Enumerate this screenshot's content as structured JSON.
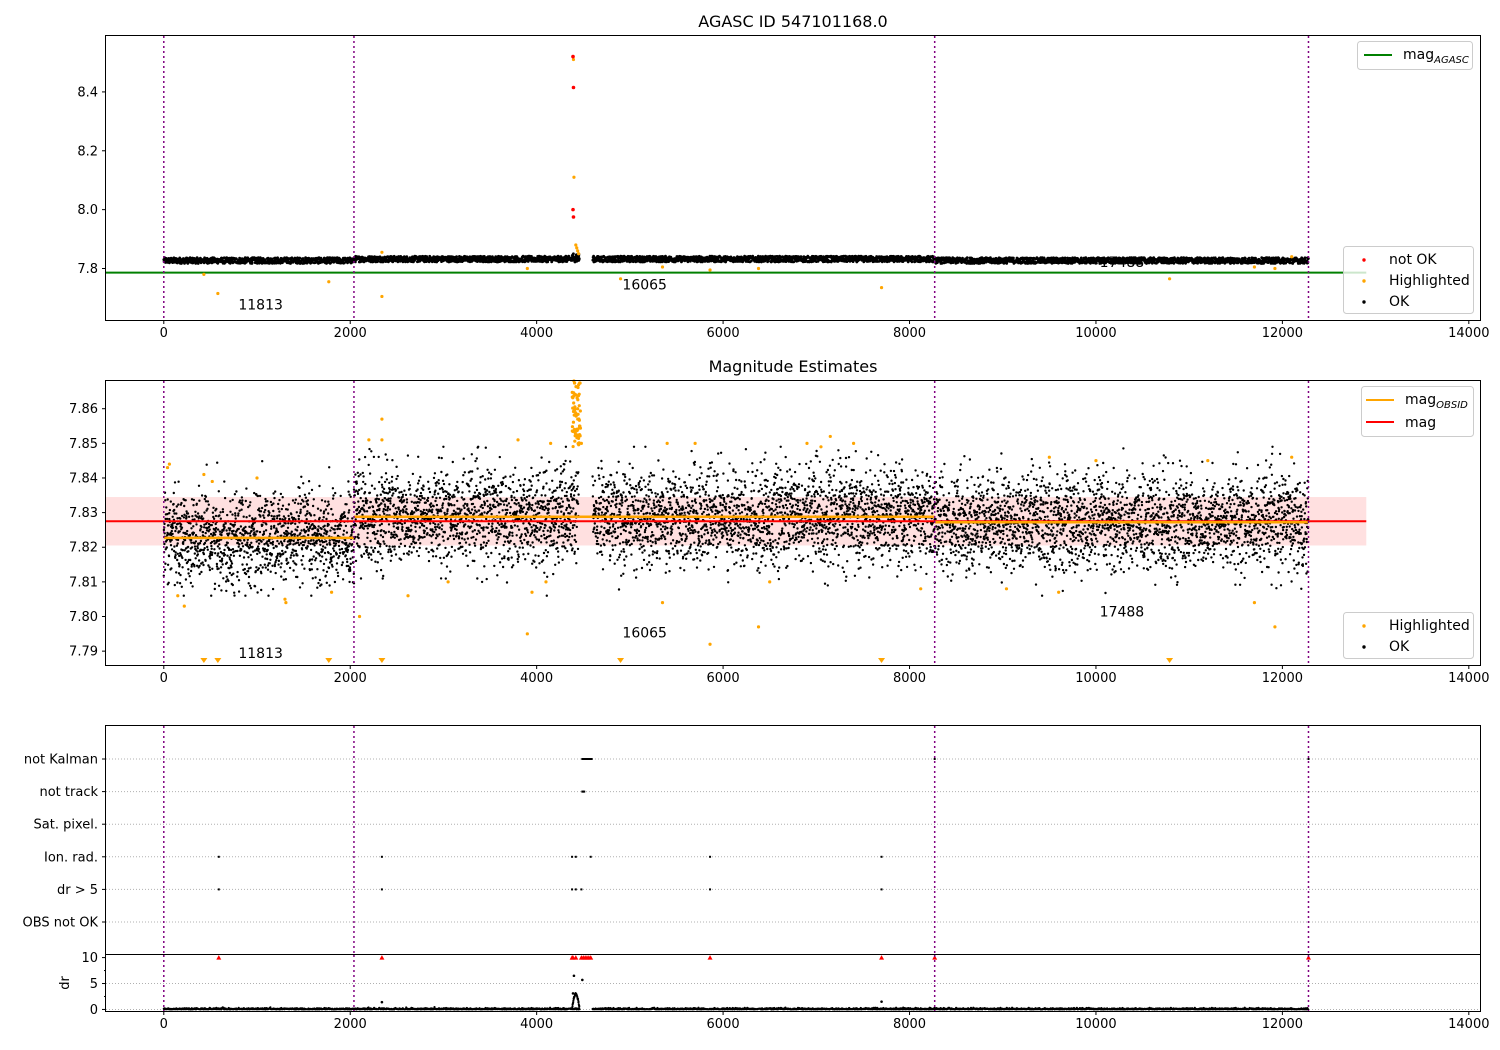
{
  "chart_data": [
    {
      "type": "scatter",
      "title": "AGASC ID 547101168.0",
      "xlim": [
        -620,
        14120
      ],
      "ylim": [
        7.625,
        8.59
      ],
      "xticks": [
        0,
        2000,
        4000,
        6000,
        8000,
        10000,
        12000,
        14000
      ],
      "yticks": [
        7.8,
        8.0,
        8.2,
        8.4
      ],
      "xtick_labels": [
        "0",
        "2000",
        "4000",
        "6000",
        "8000",
        "10000",
        "12000",
        "14000"
      ],
      "ytick_labels": [
        "7.8",
        "8.0",
        "8.2",
        "8.4"
      ],
      "obsid_boundaries": [
        0,
        2040,
        8270,
        12280
      ],
      "obsid_labels": [
        {
          "text": "11813",
          "x": 800,
          "y": 7.66
        },
        {
          "text": "16065",
          "x": 4920,
          "y": 7.728
        },
        {
          "text": "17488",
          "x": 10040,
          "y": 7.805
        }
      ],
      "mag_agasc": 7.786,
      "ok_band": {
        "base": 7.827,
        "amp": 0.01
      },
      "highlighted": [
        [
          4390,
          8.52
        ],
        [
          4395,
          8.51
        ],
        [
          4400,
          8.11
        ],
        [
          4420,
          7.88
        ],
        [
          4430,
          7.87
        ],
        [
          4440,
          7.86
        ],
        [
          4450,
          7.85
        ],
        [
          430,
          7.78
        ],
        [
          580,
          7.715
        ],
        [
          1770,
          7.755
        ],
        [
          2340,
          7.705
        ],
        [
          2340,
          7.855
        ],
        [
          3900,
          7.8
        ],
        [
          4900,
          7.765
        ],
        [
          5350,
          7.805
        ],
        [
          5860,
          7.795
        ],
        [
          6380,
          7.8
        ],
        [
          7700,
          7.735
        ],
        [
          10790,
          7.765
        ],
        [
          11700,
          7.805
        ],
        [
          11920,
          7.8
        ],
        [
          12100,
          7.84
        ]
      ],
      "not_ok": [
        [
          4390,
          8.52
        ],
        [
          4395,
          8.415
        ],
        [
          4390,
          8.0
        ],
        [
          4395,
          7.975
        ]
      ],
      "legend_upper": [
        {
          "label": "mag",
          "sub": "AGASC",
          "color": "#008000"
        }
      ],
      "legend_lower": [
        {
          "label": "not OK",
          "color": "#ff0000"
        },
        {
          "label": "Highlighted",
          "color": "#ffa500"
        },
        {
          "label": "OK",
          "color": "#000000"
        }
      ]
    },
    {
      "type": "scatter",
      "title": "Magnitude Estimates",
      "xlim": [
        -620,
        14120
      ],
      "ylim": [
        7.786,
        7.868
      ],
      "xticks": [
        0,
        2000,
        4000,
        6000,
        8000,
        10000,
        12000,
        14000
      ],
      "yticks": [
        7.79,
        7.8,
        7.81,
        7.82,
        7.83,
        7.84,
        7.85,
        7.86
      ],
      "xtick_labels": [
        "0",
        "2000",
        "4000",
        "6000",
        "8000",
        "10000",
        "12000",
        "14000"
      ],
      "ytick_labels": [
        "7.79",
        "7.80",
        "7.81",
        "7.82",
        "7.83",
        "7.84",
        "7.85",
        "7.86"
      ],
      "obsid_boundaries": [
        0,
        2040,
        8270,
        12280
      ],
      "obsid_labels": [
        {
          "text": "11813",
          "x": 800,
          "y": 7.788
        },
        {
          "text": "16065",
          "x": 4920,
          "y": 7.794
        },
        {
          "text": "17488",
          "x": 10040,
          "y": 7.8
        }
      ],
      "mag": 7.8275,
      "mag_band": [
        7.8205,
        7.8345
      ],
      "mag_obsid": [
        {
          "x0": 0,
          "x1": 2040,
          "y": 7.8227
        },
        {
          "x0": 2040,
          "x1": 8270,
          "y": 7.8288
        },
        {
          "x0": 8270,
          "x1": 12280,
          "y": 7.8272
        }
      ],
      "ok_segments": [
        {
          "x0": 0,
          "x1": 2040,
          "mean": 7.8227,
          "sd": 0.0065
        },
        {
          "x0": 2040,
          "x1": 4450,
          "mean": 7.829,
          "sd": 0.0068
        },
        {
          "x0": 4600,
          "x1": 8270,
          "mean": 7.8288,
          "sd": 0.0068
        },
        {
          "x0": 8270,
          "x1": 12280,
          "mean": 7.8272,
          "sd": 0.0068
        }
      ],
      "highlighted": [
        [
          40,
          7.843
        ],
        [
          60,
          7.844
        ],
        [
          430,
          7.841
        ],
        [
          520,
          7.839
        ],
        [
          1000,
          7.84
        ],
        [
          1300,
          7.805
        ],
        [
          1310,
          7.804
        ],
        [
          2100,
          7.8
        ],
        [
          2200,
          7.851
        ],
        [
          2340,
          7.857
        ],
        [
          2340,
          7.851
        ],
        [
          2620,
          7.806
        ],
        [
          3050,
          7.81
        ],
        [
          3800,
          7.851
        ],
        [
          3900,
          7.795
        ],
        [
          3950,
          7.807
        ],
        [
          4100,
          7.81
        ],
        [
          4150,
          7.85
        ],
        [
          4400,
          7.868
        ],
        [
          4420,
          7.864
        ],
        [
          4440,
          7.86
        ],
        [
          4460,
          7.855
        ],
        [
          4480,
          7.85
        ],
        [
          5350,
          7.804
        ],
        [
          5400,
          7.85
        ],
        [
          5700,
          7.85
        ],
        [
          5860,
          7.792
        ],
        [
          6380,
          7.797
        ],
        [
          6500,
          7.81
        ],
        [
          6900,
          7.85
        ],
        [
          7050,
          7.849
        ],
        [
          7150,
          7.852
        ],
        [
          7400,
          7.85
        ],
        [
          8120,
          7.808
        ],
        [
          9040,
          7.808
        ],
        [
          9500,
          7.846
        ],
        [
          9600,
          7.807
        ],
        [
          10000,
          7.845
        ],
        [
          11200,
          7.845
        ],
        [
          11700,
          7.804
        ],
        [
          11920,
          7.797
        ],
        [
          12100,
          7.846
        ],
        [
          150,
          7.806
        ],
        [
          220,
          7.803
        ],
        [
          1800,
          7.807
        ]
      ],
      "off_scale_markers": [
        430,
        580,
        1770,
        2340,
        4900,
        7700,
        10790
      ],
      "legend_upper": [
        {
          "label": "mag",
          "sub": "OBSID",
          "color": "#ffa500"
        },
        {
          "label": "mag",
          "color": "#ff0000"
        }
      ],
      "legend_lower": [
        {
          "label": "Highlighted",
          "color": "#ffa500"
        },
        {
          "label": "OK",
          "color": "#000000"
        }
      ]
    },
    {
      "type": "scatter",
      "xlim": [
        -620,
        14120
      ],
      "xticks": [
        0,
        2000,
        4000,
        6000,
        8000,
        10000,
        12000,
        14000
      ],
      "xtick_labels": [
        "0",
        "2000",
        "4000",
        "6000",
        "8000",
        "10000",
        "12000",
        "14000"
      ],
      "obsid_boundaries": [
        0,
        2040,
        8270,
        12280
      ],
      "flag_rows": [
        "not Kalman",
        "not track",
        "Sat. pixel.",
        "Ion. rad.",
        "dr > 5",
        "OBS not OK"
      ],
      "flag_points": {
        "not Kalman": [
          4490,
          4500,
          4510,
          4520,
          4530,
          4540,
          4550,
          4560,
          4570,
          4580,
          4590,
          8270,
          12280
        ],
        "not track": [
          4490,
          4500,
          4510
        ],
        "Sat. pixel.": [],
        "Ion. rad.": [
          590,
          2340,
          4380,
          4420,
          4580,
          5860,
          7700
        ],
        "dr > 5": [
          590,
          2340,
          4380,
          4420,
          4480,
          5860,
          7700
        ],
        "OBS not OK": []
      },
      "dr_ylabel": "dr",
      "dr_ylim": [
        -0.3,
        10.5
      ],
      "dr_yticks": [
        0,
        5,
        10
      ],
      "dr_ytick_labels": [
        "0",
        "5",
        "10"
      ],
      "dr_capped": [
        590,
        2340,
        4380,
        4390,
        4420,
        4480,
        4500,
        4520,
        4540,
        4560,
        4580,
        5860,
        7700,
        8270,
        12280
      ],
      "dr_spikes": [
        [
          4400,
          6.5
        ],
        [
          4490,
          5.7
        ],
        [
          4390,
          3.1
        ],
        [
          2340,
          1.4
        ],
        [
          7700,
          1.5
        ]
      ],
      "dr_bump": {
        "x0": 4380,
        "x1": 4460,
        "peak": 2.8
      }
    }
  ]
}
